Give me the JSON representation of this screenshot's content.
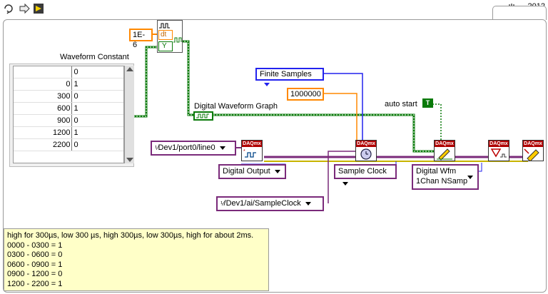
{
  "version": "2012",
  "dt_constant": "1E-6",
  "build_waveform": {
    "dt_label": "dt",
    "y_label": "Y"
  },
  "waveform_constant": {
    "label": "Waveform Constant",
    "header": "0",
    "rows": [
      {
        "index": "0",
        "value": "1"
      },
      {
        "index": "300",
        "value": "0"
      },
      {
        "index": "600",
        "value": "1"
      },
      {
        "index": "900",
        "value": "0"
      },
      {
        "index": "1200",
        "value": "1"
      },
      {
        "index": "2200",
        "value": "0"
      }
    ]
  },
  "graph_label": "Digital Waveform Graph",
  "sample_mode": "Finite Samples",
  "samples_constant": "1000000",
  "auto_start": {
    "label": "auto start",
    "value": "T"
  },
  "channel_line": "Dev1/port0/line0",
  "channel_type": "Digital Output",
  "timing_type": "Sample Clock",
  "clock_source": "/Dev1/ai/SampleClock",
  "write_type_line1": "Digital Wfm",
  "write_type_line2": "1Chan NSamp",
  "daq_label": "DAQmx",
  "comment_lines": [
    "high for 300µs, low 300 µs, high 300µs, low 300µs, high for about 2ms.",
    "0000 - 0300 = 1",
    "0300 - 0600 = 0",
    "0600 - 0900 = 1",
    "0900 - 1200 = 0",
    "1200 - 2200 = 1"
  ]
}
